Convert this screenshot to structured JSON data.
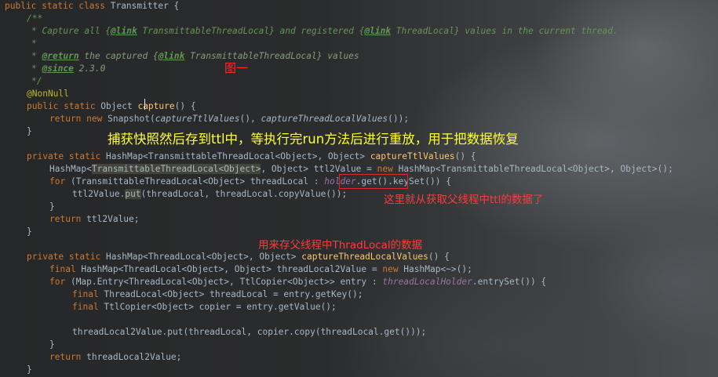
{
  "code": {
    "l1": {
      "kw": "public static class",
      "rest": " Transmitter {"
    },
    "l2": "/**",
    "l3": {
      "a": "* Capture all {",
      "tag1": "@link",
      "b": " TransmittableThreadLocal} and registered {",
      "tag2": "@link",
      "c": " ThreadLocal} values in the current thread."
    },
    "l4": "*",
    "l5": {
      "tag1": "@return",
      "a": " the captured {",
      "tag2": "@link",
      "b": " TransmittableThreadLocal} values"
    },
    "l6": {
      "tag": "@since",
      "a": " 2.3.0"
    },
    "l7": "*/",
    "l8": "@NonNull",
    "l9": {
      "kw": "public static",
      "a": " Object ",
      "fn": "capture",
      "b": "() {"
    },
    "l10": {
      "kw1": "return",
      "kw2": "new",
      "a": " Snapshot(",
      "m1": "captureTtlValues",
      "b": "(), ",
      "m2": "captureThreadLocalValues",
      "c": "());"
    },
    "l11": "}",
    "l12": {
      "kw": "private static",
      "a": " HashMap<TransmittableThreadLocal<Object>, Object> ",
      "fn": "captureTtlValues",
      "b": "() {"
    },
    "l13": {
      "a": "HashMap<",
      "b": "TransmittableThreadLocal<Object>",
      "c": ", Object> ttl2Value = ",
      "kw": "new",
      "d": " HashMap<TransmittableThreadLocal<Object>, Object>();"
    },
    "l14": {
      "kw": "for",
      "a": " (TransmittableThreadLocal<Object> threadLocal : ",
      "field": "holder",
      "b": ".get().keySet()) {"
    },
    "l15": {
      "a": "ttl2Value.",
      "b": "put",
      "c": "(threadLocal, threadLocal.copyValue());"
    },
    "l16": "}",
    "l17": {
      "kw": "return",
      "a": " ttl2Value;"
    },
    "l18": "}",
    "l19": {
      "kw": "private static",
      "a": " HashMap<ThreadLocal<Object>, Object> ",
      "fn": "captureThreadLocalValues",
      "b": "() {"
    },
    "l20": {
      "kw1": "final",
      "a": " HashMap<ThreadLocal<Object>, Object> threadLocal2Value = ",
      "kw2": "new",
      "b": " HashMap<~>();"
    },
    "l21": {
      "kw": "for",
      "a": " (Map.Entry<ThreadLocal<Object>, TtlCopier<Object>> entry : ",
      "field": "threadLocalHolder",
      "b": ".entrySet()) {"
    },
    "l22": {
      "kw": "final",
      "a": " ThreadLocal<Object> threadLocal = entry.getKey();"
    },
    "l23": {
      "kw": "final",
      "a": " TtlCopier<Object> copier = entry.getValue();"
    },
    "l25": "threadLocal2Value.put(threadLocal, copier.copy(threadLocal.get()));",
    "l26": "}",
    "l27": {
      "kw": "return",
      "a": " threadLocal2Value;"
    },
    "l28": "}"
  },
  "annotations": {
    "figure": "图一",
    "main": "捕获快照然后存到ttl中，等执行完run方法后进行重放，用于把数据恢复",
    "holder": "这里就从获取父线程中ttl的数据了",
    "threadlocal": "用来存父线程中ThradLocal的数据"
  },
  "colors": {
    "keyword": "#cc7832",
    "comment": "#629755",
    "method_decl": "#ffc66d",
    "annotation": "#bbb529",
    "field": "#9876aa",
    "text": "#a9b7c6",
    "note_yellow": "#ffff33",
    "note_red": "#ff3b3b"
  }
}
